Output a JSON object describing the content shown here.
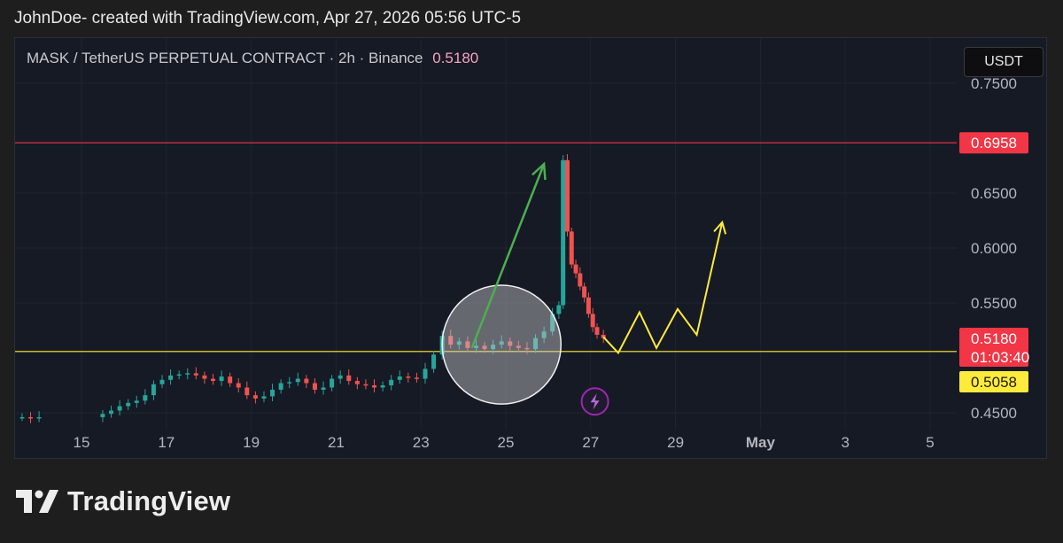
{
  "header": {
    "attribution": "JohnDoe- created with TradingView.com, Apr 27, 2026 05:56 UTC-5"
  },
  "legend": {
    "symbol": "MASK / TetherUS PERPETUAL CONTRACT · 2h · Binance",
    "last_price": "0.5180"
  },
  "currency_button": "USDT",
  "footer": {
    "brand": "TradingView"
  },
  "colors": {
    "up": "#26a69a",
    "down": "#ef5350",
    "resistance": "#f23645",
    "support": "#ffeb3b",
    "green_arrow": "#4caf50",
    "yellow_path": "#ffeb3b",
    "badge_red": "#f23645",
    "badge_yellow": "#ffeb3b"
  },
  "chart_data": {
    "type": "candlestick",
    "y_axis": {
      "ticks": [
        "0.7500",
        "0.6500",
        "0.6000",
        "0.5500",
        "0.4500"
      ],
      "range": [
        0.44,
        0.75
      ]
    },
    "x_axis": {
      "ticks": [
        "15",
        "17",
        "19",
        "21",
        "23",
        "25",
        "27",
        "29",
        "May",
        "3",
        "5"
      ],
      "tick_dates": [
        15,
        17,
        19,
        21,
        23,
        25,
        27,
        29,
        31,
        33,
        35
      ],
      "range_days": [
        13.45,
        36.0
      ]
    },
    "horizontal_lines": [
      {
        "name": "resistance",
        "price": 0.6958,
        "label": "0.6958"
      },
      {
        "name": "support",
        "price": 0.5058,
        "label": "0.5058"
      }
    ],
    "price_badges": {
      "current": {
        "price": "0.5180",
        "countdown": "01:03:40"
      }
    },
    "closes": [
      {
        "d": 13.6,
        "c": 0.446
      },
      {
        "d": 13.8,
        "c": 0.445
      },
      {
        "d": 14.0,
        "c": 0.446
      },
      {
        "d": 15.5,
        "c": 0.449
      },
      {
        "d": 15.7,
        "c": 0.452
      },
      {
        "d": 15.9,
        "c": 0.456
      },
      {
        "d": 16.1,
        "c": 0.459
      },
      {
        "d": 16.3,
        "c": 0.461
      },
      {
        "d": 16.5,
        "c": 0.466
      },
      {
        "d": 16.7,
        "c": 0.476
      },
      {
        "d": 16.9,
        "c": 0.48
      },
      {
        "d": 17.1,
        "c": 0.484
      },
      {
        "d": 17.3,
        "c": 0.485
      },
      {
        "d": 17.5,
        "c": 0.486
      },
      {
        "d": 17.7,
        "c": 0.484
      },
      {
        "d": 17.9,
        "c": 0.481
      },
      {
        "d": 18.1,
        "c": 0.479
      },
      {
        "d": 18.3,
        "c": 0.483
      },
      {
        "d": 18.5,
        "c": 0.477
      },
      {
        "d": 18.7,
        "c": 0.473
      },
      {
        "d": 18.9,
        "c": 0.466
      },
      {
        "d": 19.1,
        "c": 0.463
      },
      {
        "d": 19.3,
        "c": 0.465
      },
      {
        "d": 19.5,
        "c": 0.471
      },
      {
        "d": 19.7,
        "c": 0.477
      },
      {
        "d": 19.9,
        "c": 0.478
      },
      {
        "d": 20.1,
        "c": 0.481
      },
      {
        "d": 20.3,
        "c": 0.477
      },
      {
        "d": 20.5,
        "c": 0.471
      },
      {
        "d": 20.7,
        "c": 0.473
      },
      {
        "d": 20.9,
        "c": 0.481
      },
      {
        "d": 21.1,
        "c": 0.484
      },
      {
        "d": 21.3,
        "c": 0.479
      },
      {
        "d": 21.5,
        "c": 0.476
      },
      {
        "d": 21.7,
        "c": 0.475
      },
      {
        "d": 21.9,
        "c": 0.473
      },
      {
        "d": 22.1,
        "c": 0.475
      },
      {
        "d": 22.3,
        "c": 0.48
      },
      {
        "d": 22.5,
        "c": 0.483
      },
      {
        "d": 22.7,
        "c": 0.482
      },
      {
        "d": 22.9,
        "c": 0.481
      },
      {
        "d": 23.1,
        "c": 0.49
      },
      {
        "d": 23.3,
        "c": 0.503
      },
      {
        "d": 23.5,
        "c": 0.52
      },
      {
        "d": 23.7,
        "c": 0.512
      },
      {
        "d": 23.9,
        "c": 0.515
      },
      {
        "d": 24.1,
        "c": 0.509
      },
      {
        "d": 24.3,
        "c": 0.511
      },
      {
        "d": 24.5,
        "c": 0.508
      },
      {
        "d": 24.7,
        "c": 0.512
      },
      {
        "d": 24.9,
        "c": 0.515
      },
      {
        "d": 25.1,
        "c": 0.511
      },
      {
        "d": 25.3,
        "c": 0.509
      },
      {
        "d": 25.5,
        "c": 0.508
      },
      {
        "d": 25.7,
        "c": 0.518
      },
      {
        "d": 25.9,
        "c": 0.524
      },
      {
        "d": 26.1,
        "c": 0.54
      },
      {
        "d": 26.25,
        "c": 0.548
      },
      {
        "d": 26.35,
        "c": 0.68
      },
      {
        "d": 26.45,
        "c": 0.615
      },
      {
        "d": 26.55,
        "c": 0.585
      },
      {
        "d": 26.65,
        "c": 0.577
      },
      {
        "d": 26.75,
        "c": 0.565
      },
      {
        "d": 26.85,
        "c": 0.555
      },
      {
        "d": 26.95,
        "c": 0.54
      },
      {
        "d": 27.05,
        "c": 0.528
      },
      {
        "d": 27.15,
        "c": 0.521
      },
      {
        "d": 27.3,
        "c": 0.518
      }
    ],
    "drawings": {
      "circle": {
        "cx_day": 24.9,
        "cy_price": 0.512,
        "r_days": 1.4
      },
      "green_arrow": [
        {
          "d": 24.2,
          "p": 0.509
        },
        {
          "d": 25.9,
          "p": 0.6765
        }
      ],
      "yellow_path": [
        {
          "d": 27.3,
          "p": 0.519
        },
        {
          "d": 27.65,
          "p": 0.5045
        },
        {
          "d": 28.15,
          "p": 0.5415
        },
        {
          "d": 28.55,
          "p": 0.509
        },
        {
          "d": 29.05,
          "p": 0.5445
        },
        {
          "d": 29.5,
          "p": 0.521
        },
        {
          "d": 30.1,
          "p": 0.6235
        }
      ],
      "lightning_icon": {
        "d": 27.1,
        "p": 0.4603
      }
    }
  }
}
